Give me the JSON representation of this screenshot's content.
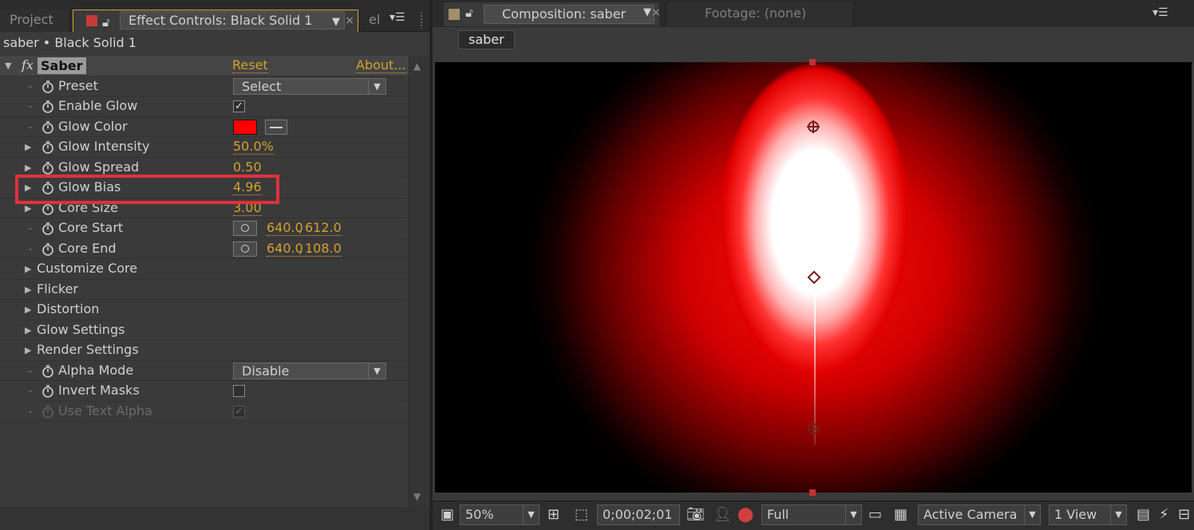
{
  "left_panel": {
    "tabs": {
      "project": "Project",
      "effect_controls": "Effect Controls: Black Solid 1",
      "overflow": "el"
    },
    "layer_path": "saber • Black Solid 1",
    "effect": {
      "name": "Saber",
      "fx_label": "fx",
      "reset_label": "Reset",
      "about_label": "About..."
    },
    "properties": {
      "preset": {
        "label": "Preset",
        "value": "Select"
      },
      "enable_glow": {
        "label": "Enable Glow",
        "checked": true,
        "check_glyph": "✓"
      },
      "glow_color": {
        "label": "Glow Color",
        "color": "#ff0000"
      },
      "glow_intensity": {
        "label": "Glow Intensity",
        "value": "50.0%"
      },
      "glow_spread": {
        "label": "Glow Spread",
        "value": "0.50"
      },
      "glow_bias": {
        "label": "Glow Bias",
        "value": "4.96"
      },
      "core_size": {
        "label": "Core Size",
        "value": "3.00"
      },
      "core_start": {
        "label": "Core Start",
        "x": "640.0",
        "y": "612.0"
      },
      "core_end": {
        "label": "Core End",
        "x": "640.0",
        "y": "108.0"
      },
      "customize_core": {
        "label": "Customize Core"
      },
      "flicker": {
        "label": "Flicker"
      },
      "distortion": {
        "label": "Distortion"
      },
      "glow_settings": {
        "label": "Glow Settings"
      },
      "render_settings": {
        "label": "Render Settings"
      },
      "alpha_mode": {
        "label": "Alpha Mode",
        "value": "Disable"
      },
      "invert_masks": {
        "label": "Invert Masks",
        "checked": false
      },
      "use_text_alpha": {
        "label": "Use Text Alpha",
        "checked": true,
        "disabled": true,
        "check_glyph": "✓"
      }
    },
    "separator": ","
  },
  "right_panel": {
    "composition_tab": "Composition: saber",
    "footage_tab": "Footage: (none)",
    "comp_name": "saber",
    "viewer_toolbar": {
      "zoom": "50%",
      "timecode": "0;00;02;01",
      "resolution": "Full",
      "camera": "Active Camera",
      "views": "1 View"
    }
  },
  "colors": {
    "accent_value": "#d3a12e",
    "highlight": "#e0303e",
    "active_tab_border": "#c9a23a"
  }
}
